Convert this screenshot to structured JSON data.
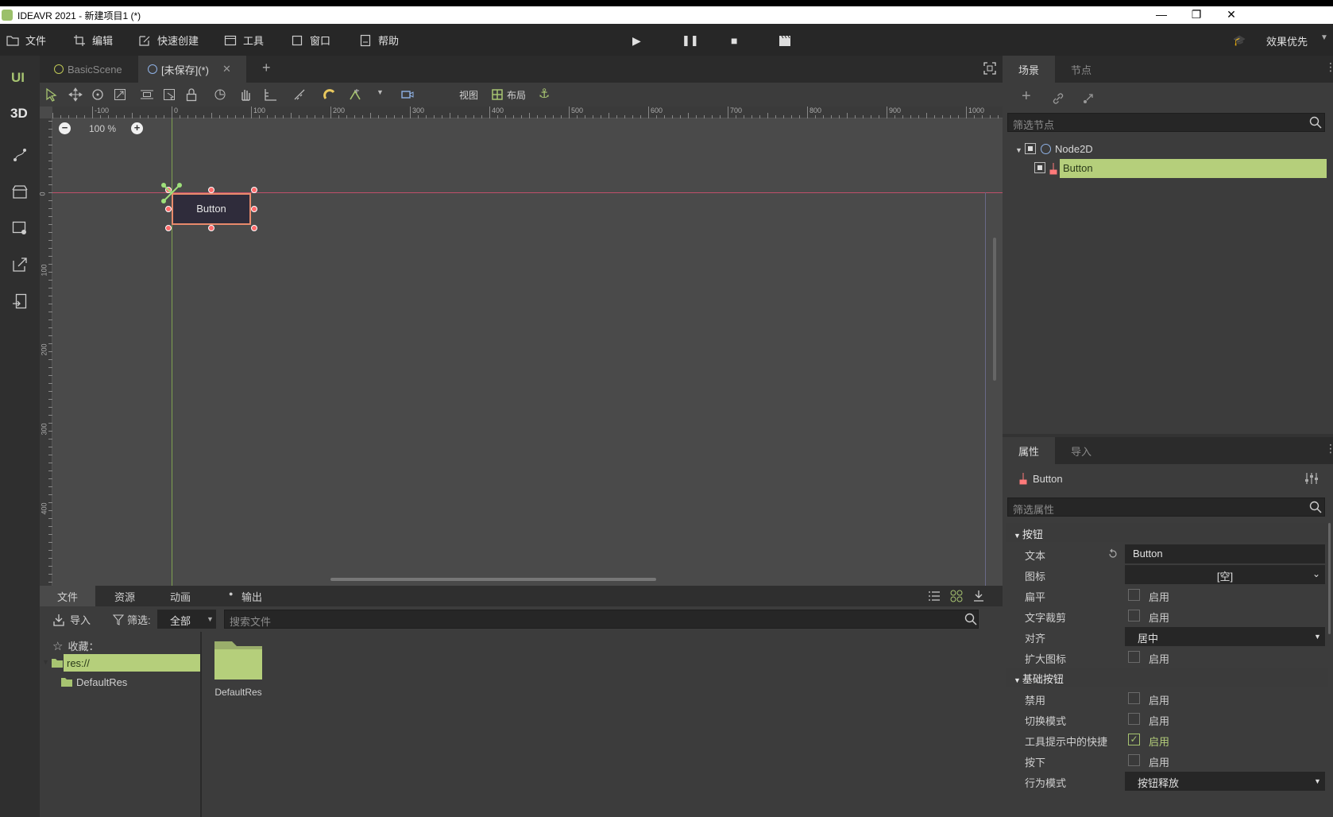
{
  "window": {
    "title": "IDEAVR 2021 - 新建项目1 (*)",
    "controls": {
      "minimize": "—",
      "maximize": "❐",
      "close": "✕"
    }
  },
  "menubar": {
    "items": [
      {
        "label": "文件",
        "icon": "folder-icon"
      },
      {
        "label": "编辑",
        "icon": "crop-icon"
      },
      {
        "label": "快速创建",
        "icon": "edit-icon"
      },
      {
        "label": "工具",
        "icon": "window-icon"
      },
      {
        "label": "窗口",
        "icon": "frame-icon"
      },
      {
        "label": "帮助",
        "icon": "book-icon"
      }
    ],
    "render_mode": "效果优先"
  },
  "leftbar": {
    "ui_label": "UI",
    "d3_label": "3D"
  },
  "scene_tabs": [
    {
      "label": "BasicScene",
      "active": false
    },
    {
      "label": "[未保存](*)",
      "active": true
    }
  ],
  "toolbar": {
    "view_label": "视图",
    "layout_label": "布局"
  },
  "ruler": {
    "h_ticks": [
      "-100",
      "0",
      "100",
      "200",
      "300",
      "400",
      "500",
      "600",
      "700",
      "800",
      "900",
      "1000"
    ],
    "v_ticks": [
      "0",
      "100",
      "200",
      "300",
      "400"
    ]
  },
  "viewport": {
    "zoom": "100 %",
    "button_label": "Button"
  },
  "bottom": {
    "tabs": [
      "文件",
      "资源",
      "动画",
      "输出"
    ],
    "import_label": "导入",
    "filter_label": "筛选:",
    "filter_value": "全部",
    "search_placeholder": "搜索文件",
    "favorites_label": "收藏：",
    "tree": [
      "res://",
      "DefaultRes"
    ],
    "folder_name": "DefaultRes"
  },
  "scene_panel": {
    "tabs": [
      "场景",
      "节点"
    ],
    "filter_placeholder": "筛选节点",
    "nodes": [
      {
        "name": "Node2D"
      },
      {
        "name": "Button"
      }
    ]
  },
  "inspector": {
    "tabs": [
      "属性",
      "导入"
    ],
    "object_name": "Button",
    "filter_placeholder": "筛选属性",
    "sections": [
      {
        "title": "按钮",
        "rows": [
          {
            "label": "文本",
            "value": "Button"
          },
          {
            "label": "图标",
            "value": "[空]"
          },
          {
            "label": "扁平",
            "value": "启用"
          },
          {
            "label": "文字裁剪",
            "value": "启用"
          },
          {
            "label": "对齐",
            "value": "居中"
          },
          {
            "label": "扩大图标",
            "value": "启用"
          }
        ]
      },
      {
        "title": "基础按钮",
        "rows": [
          {
            "label": "禁用",
            "value": "启用"
          },
          {
            "label": "切换模式",
            "value": "启用"
          },
          {
            "label": "工具提示中的快捷",
            "value": "启用",
            "checked": true
          },
          {
            "label": "按下",
            "value": "启用"
          },
          {
            "label": "行为模式",
            "value": "按钮释放"
          }
        ]
      }
    ]
  },
  "colors": {
    "accent": "#a7c471",
    "selection": "#b5cf7b",
    "handle": "#ff6b6b"
  }
}
